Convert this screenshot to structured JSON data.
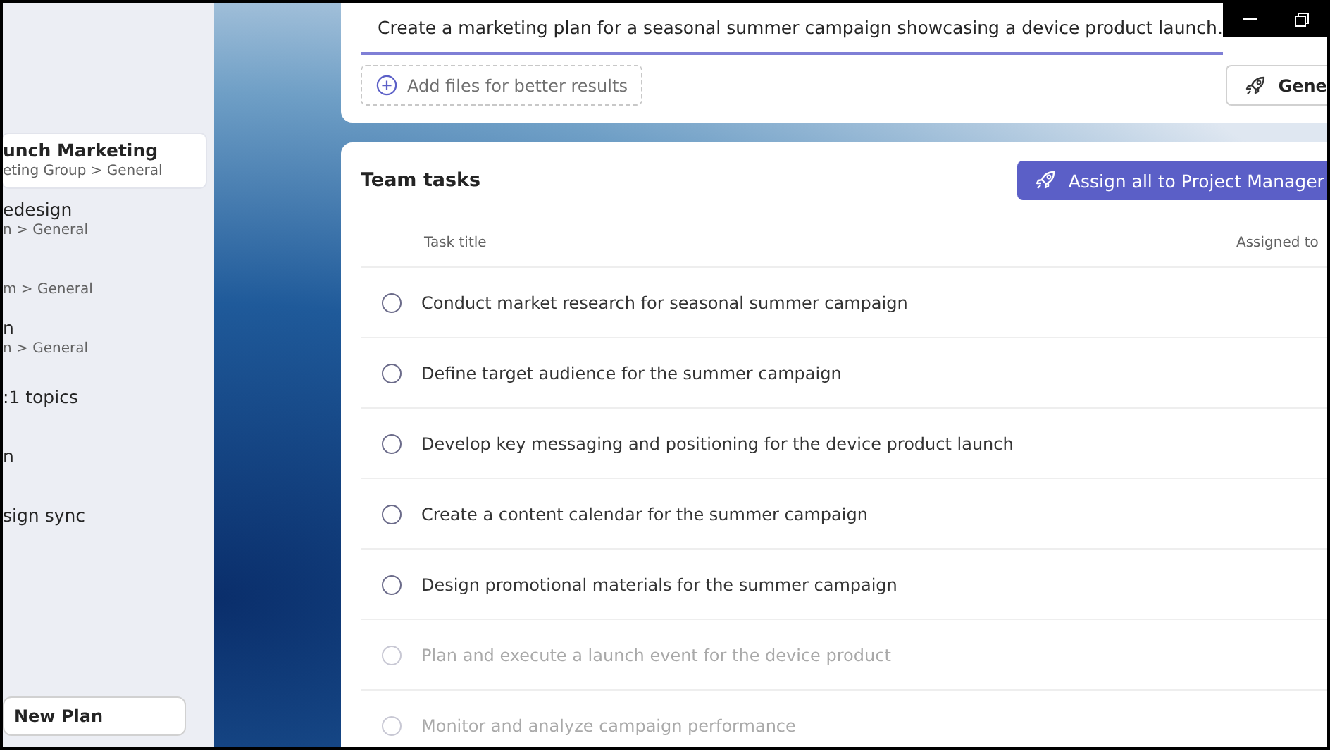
{
  "sidebar": {
    "items": [
      {
        "title": "unch Marketing",
        "subtitle": "eting Group > General",
        "selected": true
      },
      {
        "title": "edesign",
        "subtitle": "n > General",
        "selected": false
      },
      {
        "subtitle": "m > General",
        "selected": false
      },
      {
        "title": "n",
        "subtitle": "n > General",
        "selected": false
      },
      {
        "title": ":1 topics",
        "selected": false
      },
      {
        "title": "n",
        "selected": false
      },
      {
        "title": "sign sync",
        "selected": false
      }
    ],
    "new_plan_button": "New Plan"
  },
  "prompt": {
    "value": "Create a marketing plan for a seasonal summer campaign showcasing a device product launch.",
    "add_files": "Add files for better results",
    "generate_button": "Gene"
  },
  "team_tasks": {
    "title": "Team tasks",
    "assign_button": "Assign all to Project Manager",
    "columns": [
      "Task title",
      "Assigned to"
    ],
    "rows": [
      {
        "title": "Conduct market research for seasonal summer campaign",
        "checked": false,
        "faded": false
      },
      {
        "title": "Define target audience for the summer campaign",
        "checked": false,
        "faded": false
      },
      {
        "title": "Develop key messaging and positioning for the device product launch",
        "checked": false,
        "faded": false
      },
      {
        "title": "Create a content calendar for the summer campaign",
        "checked": false,
        "faded": false
      },
      {
        "title": "Design promotional materials for the summer campaign",
        "checked": false,
        "faded": false
      },
      {
        "title": "Plan and execute a launch event for the device product",
        "checked": false,
        "faded": true
      },
      {
        "title": "Monitor and analyze campaign performance",
        "checked": false,
        "faded": true
      }
    ]
  }
}
